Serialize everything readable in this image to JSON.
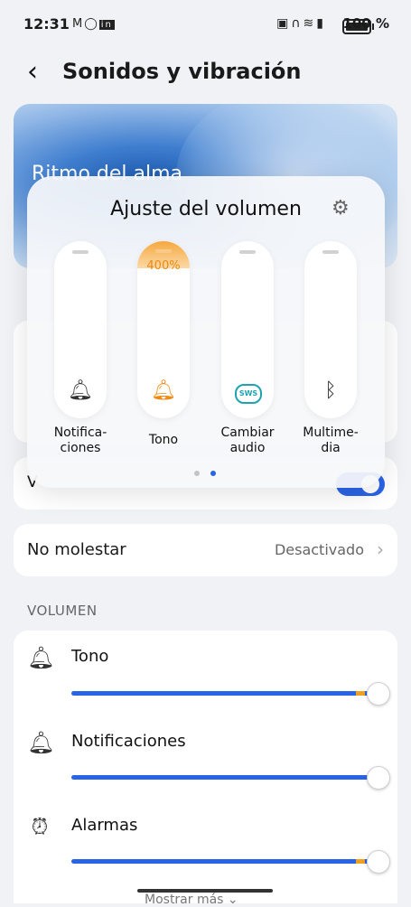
{
  "status_bar": {
    "time": "12:31",
    "left_icons": "M ◯ in",
    "battery_pct": "100 %"
  },
  "header": {
    "title": "Sonidos y vibración"
  },
  "banner": {
    "text": "Ritmo del alma"
  },
  "volume_dialog": {
    "title": "Ajuste del volumen",
    "sliders": [
      {
        "label": "Notifica-\nciones",
        "label_l1": "Notifica-",
        "label_l2": "ciones",
        "icon": "bell-alert-icon"
      },
      {
        "label_l1": "Tono",
        "label_l2": "",
        "icon": "bell-icon",
        "value_text": "400%"
      },
      {
        "label_l1": "Cambiar",
        "label_l2": "audio",
        "icon": "sws-icon",
        "icon_text": "SWS"
      },
      {
        "label_l1": "Multime-",
        "label_l2": "dia",
        "icon": "bluetooth-icon"
      }
    ],
    "page": 2,
    "pages": 2
  },
  "background_row": {
    "label": "V"
  },
  "do_not_disturb": {
    "label": "No molestar",
    "value": "Desactivado"
  },
  "section": {
    "title": "VOLUMEN"
  },
  "volume_rows": [
    {
      "label": "Tono",
      "icon": "bell-outline-icon",
      "level": 1.0
    },
    {
      "label": "Notificaciones",
      "icon": "bell-alert-outline-icon",
      "level": 1.0
    },
    {
      "label": "Alarmas",
      "icon": "alarm-clock-icon",
      "level": 1.0
    }
  ],
  "footer": {
    "more": "Mostrar más ⌄"
  },
  "colors": {
    "accent": "#2a64e6",
    "boost": "#f0a020",
    "tono": "#f08a13"
  }
}
